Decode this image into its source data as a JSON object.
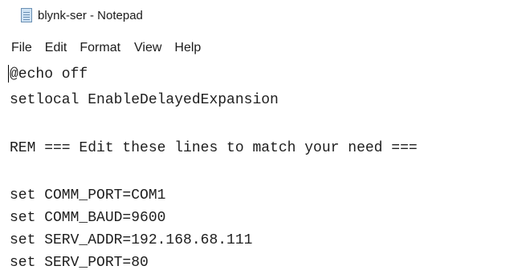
{
  "window": {
    "title": "blynk-ser - Notepad",
    "app_icon": "notepad-icon"
  },
  "menubar": {
    "file": "File",
    "edit": "Edit",
    "format": "Format",
    "view": "View",
    "help": "Help"
  },
  "editor": {
    "lines": [
      "@echo off",
      "setlocal EnableDelayedExpansion",
      "REM === Edit these lines to match your need ===",
      "set COMM_PORT=COM1",
      "set COMM_BAUD=9600",
      "set SERV_ADDR=192.168.68.111",
      "set SERV_PORT=80"
    ]
  }
}
